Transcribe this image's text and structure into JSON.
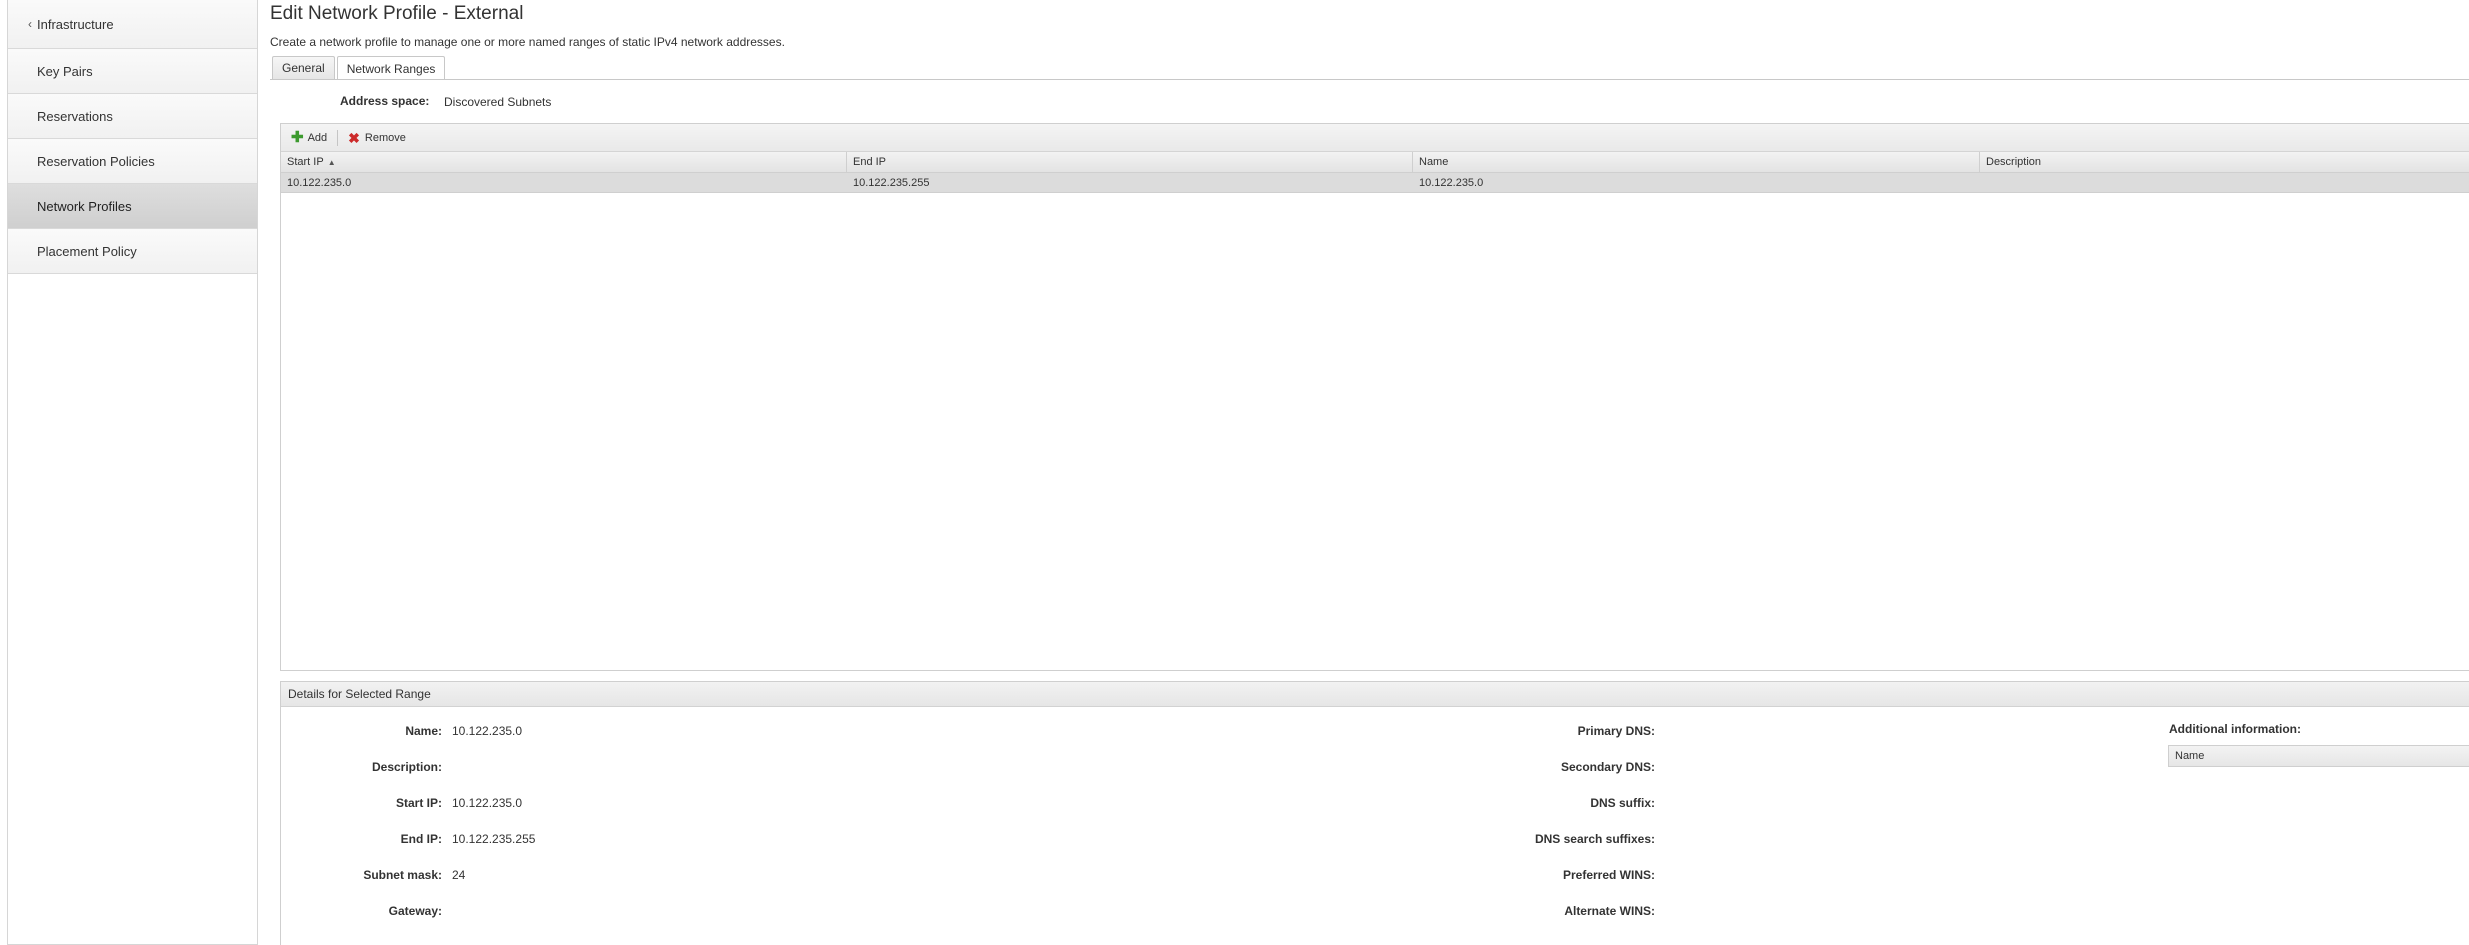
{
  "sidebar": {
    "back_label": "Infrastructure",
    "items": [
      {
        "label": "Key Pairs"
      },
      {
        "label": "Reservations"
      },
      {
        "label": "Reservation Policies"
      },
      {
        "label": "Network Profiles",
        "active": true
      },
      {
        "label": "Placement Policy"
      }
    ]
  },
  "page": {
    "title": "Edit Network Profile - External",
    "subtitle": "Create a network profile to manage one or more named ranges of static IPv4 network addresses."
  },
  "tabs": [
    {
      "label": "General"
    },
    {
      "label": "Network Ranges",
      "active": true
    }
  ],
  "address_space": {
    "label": "Address space:",
    "value": "Discovered Subnets"
  },
  "toolbar": {
    "add_label": "Add",
    "remove_label": "Remove"
  },
  "grid": {
    "columns": [
      "Start IP",
      "End IP",
      "Name",
      "Description"
    ],
    "rows": [
      {
        "start_ip": "10.122.235.0",
        "end_ip": "10.122.235.255",
        "name": "10.122.235.0",
        "description": ""
      }
    ]
  },
  "details": {
    "header": "Details for Selected Range",
    "left": [
      {
        "label": "Name:",
        "value": "10.122.235.0"
      },
      {
        "label": "Description:",
        "value": ""
      },
      {
        "label": "Start IP:",
        "value": "10.122.235.0"
      },
      {
        "label": "End IP:",
        "value": "10.122.235.255"
      },
      {
        "label": "Subnet mask:",
        "value": "24"
      },
      {
        "label": "Gateway:",
        "value": ""
      }
    ],
    "middle": [
      {
        "label": "Primary DNS:",
        "value": ""
      },
      {
        "label": "Secondary DNS:",
        "value": ""
      },
      {
        "label": "DNS suffix:",
        "value": ""
      },
      {
        "label": "DNS search suffixes:",
        "value": ""
      },
      {
        "label": "Preferred WINS:",
        "value": ""
      },
      {
        "label": "Alternate WINS:",
        "value": ""
      }
    ],
    "additional": {
      "label": "Additional information:",
      "column": "Name"
    }
  },
  "colors": {
    "selected_row": "#dcdcdc",
    "add_icon": "#3c9a2e",
    "remove_icon": "#cc2a2a"
  }
}
